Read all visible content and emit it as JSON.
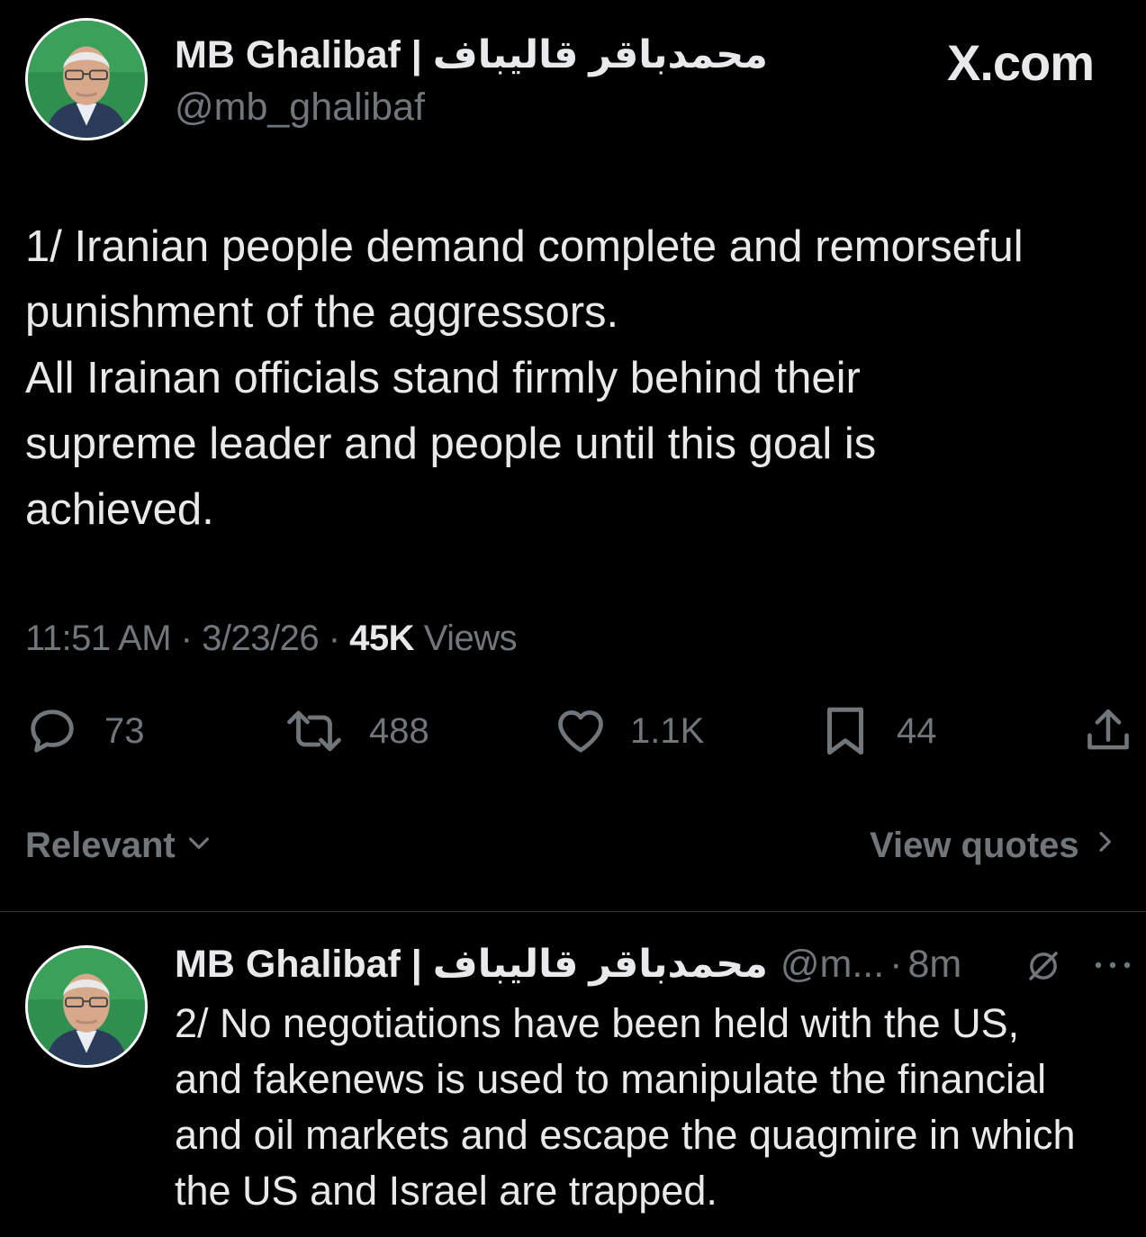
{
  "brand": {
    "label": "X.com"
  },
  "main_tweet": {
    "display_name": "MB Ghalibaf | محمدباقر قالیباف",
    "handle": "@mb_ghalibaf",
    "text_lines": [
      "1/ Iranian people demand complete and remorseful",
      "punishment of the aggressors.",
      "All Irainan officials stand firmly behind their",
      "supreme leader and people until this goal is",
      "achieved."
    ],
    "time": "11:51 AM",
    "date": "3/23/26",
    "views_count": "45K",
    "views_label": "Views",
    "separator": "·"
  },
  "actions": {
    "reply": {
      "icon": "reply-icon",
      "count": "73"
    },
    "repost": {
      "icon": "repost-icon",
      "count": "488"
    },
    "like": {
      "icon": "heart-icon",
      "count": "1.1K"
    },
    "bookmark": {
      "icon": "bookmark-icon",
      "count": "44"
    },
    "share": {
      "icon": "share-icon"
    }
  },
  "sort_bar": {
    "sort_label": "Relevant",
    "quotes_label": "View quotes"
  },
  "reply_tweet": {
    "display_name": "MB Ghalibaf | محمدباقر قالیباف",
    "handle": "@m...",
    "separator": "·",
    "time_ago": "8m",
    "text_lines": [
      "2/ No negotiations have been held with the US,",
      "and fakenews is used to manipulate the financial",
      "and oil markets and escape the quagmire in which",
      "the US and Israel are trapped."
    ]
  },
  "colors": {
    "background": "#000000",
    "text_primary": "#e7e9ea",
    "text_secondary": "#71767b",
    "divider": "#2f3336",
    "avatar_bg": "#2f8f4e"
  }
}
